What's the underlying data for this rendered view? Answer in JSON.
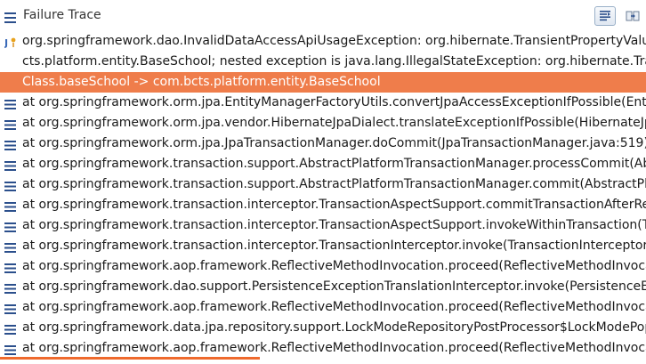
{
  "header": {
    "title": "Failure Trace",
    "icon": "failure-trace-icon",
    "filter_icon": "filter-stack-icon",
    "copy_icon": "compare-icon"
  },
  "colors": {
    "selection": "#ef7d4b",
    "frame_icon": "#2b4f8c",
    "underline": "#ef6a2d"
  },
  "trace": {
    "lines": [
      {
        "kind": "exception",
        "icon": "exception-icon",
        "text": "org.springframework.dao.InvalidDataAccessApiUsageException: org.hibernate.TransientPropertyValueEx"
      },
      {
        "kind": "continuation",
        "icon": "",
        "text": "cts.platform.entity.BaseSchool; nested exception is java.lang.IllegalStateException: org.hibernate.TransientP"
      },
      {
        "kind": "continuation-selected",
        "icon": "",
        "text": "Class.baseSchool -> com.bcts.platform.entity.BaseSchool"
      },
      {
        "kind": "frame",
        "icon": "stack-frame-icon",
        "text": "at org.springframework.orm.jpa.EntityManagerFactoryUtils.convertJpaAccessExceptionIfPossible(EntityM"
      },
      {
        "kind": "frame",
        "icon": "stack-frame-icon",
        "text": "at org.springframework.orm.jpa.vendor.HibernateJpaDialect.translateExceptionIfPossible(HibernateJpaD"
      },
      {
        "kind": "frame",
        "icon": "stack-frame-icon",
        "text": "at org.springframework.orm.jpa.JpaTransactionManager.doCommit(JpaTransactionManager.java:519)"
      },
      {
        "kind": "frame",
        "icon": "stack-frame-icon",
        "text": "at org.springframework.transaction.support.AbstractPlatformTransactionManager.processCommit(Abstr"
      },
      {
        "kind": "frame",
        "icon": "stack-frame-icon",
        "text": "at org.springframework.transaction.support.AbstractPlatformTransactionManager.commit(AbstractPlatfo"
      },
      {
        "kind": "frame",
        "icon": "stack-frame-icon",
        "text": "at org.springframework.transaction.interceptor.TransactionAspectSupport.commitTransactionAfterReturn"
      },
      {
        "kind": "frame",
        "icon": "stack-frame-icon",
        "text": "at org.springframework.transaction.interceptor.TransactionAspectSupport.invokeWithinTransaction(Tran"
      },
      {
        "kind": "frame",
        "icon": "stack-frame-icon",
        "text": "at org.springframework.transaction.interceptor.TransactionInterceptor.invoke(TransactionInterceptor.java"
      },
      {
        "kind": "frame",
        "icon": "stack-frame-icon",
        "text": "at org.springframework.aop.framework.ReflectiveMethodInvocation.proceed(ReflectiveMethodInvocation"
      },
      {
        "kind": "frame",
        "icon": "stack-frame-icon",
        "text": "at org.springframework.dao.support.PersistenceExceptionTranslationInterceptor.invoke(PersistenceExce"
      },
      {
        "kind": "frame",
        "icon": "stack-frame-icon",
        "text": "at org.springframework.aop.framework.ReflectiveMethodInvocation.proceed(ReflectiveMethodInvocation"
      },
      {
        "kind": "frame",
        "icon": "stack-frame-icon",
        "text": "at org.springframework.data.jpa.repository.support.LockModeRepositoryPostProcessor$LockModePopu"
      },
      {
        "kind": "frame",
        "icon": "stack-frame-icon",
        "text": "at org.springframework.aop.framework.ReflectiveMethodInvocation.proceed(ReflectiveMethodInvocation"
      }
    ]
  }
}
